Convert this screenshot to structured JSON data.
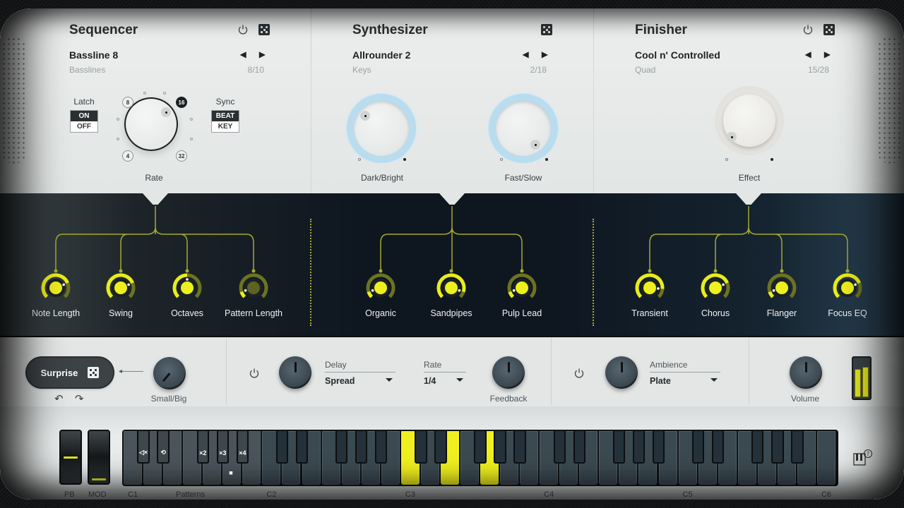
{
  "sequencer": {
    "title": "Sequencer",
    "preset": "Bassline 8",
    "category": "Basslines",
    "counter": "8/10",
    "latch": {
      "label": "Latch",
      "options": [
        "ON",
        "OFF"
      ],
      "selected": "ON"
    },
    "sync": {
      "label": "Sync",
      "options": [
        "BEAT",
        "KEY"
      ],
      "selected": "BEAT"
    },
    "rate": {
      "label": "Rate",
      "positions": [
        "4",
        "8",
        "16",
        "32"
      ],
      "selected": "16"
    },
    "icons": [
      "power-icon",
      "dice-icon"
    ]
  },
  "synthesizer": {
    "title": "Synthesizer",
    "preset": "Allrounder 2",
    "category": "Keys",
    "counter": "2/18",
    "knobs": [
      {
        "label": "Dark/Bright",
        "value": 0.15
      },
      {
        "label": "Fast/Slow",
        "value": 0.8
      }
    ],
    "icons": [
      "dice-icon"
    ]
  },
  "finisher": {
    "title": "Finisher",
    "preset": "Cool n' Controlled",
    "category": "Quad",
    "counter": "15/28",
    "knob": {
      "label": "Effect",
      "value": 0.05
    },
    "icons": [
      "power-icon",
      "dice-icon"
    ]
  },
  "macros": {
    "sequencer": [
      {
        "label": "Note Length",
        "value": 0.75
      },
      {
        "label": "Swing",
        "value": 0.75
      },
      {
        "label": "Octaves",
        "value": 0.5
      },
      {
        "label": "Pattern Length",
        "value": 0.1
      }
    ],
    "synthesizer": [
      {
        "label": "Organic",
        "value": 0.1
      },
      {
        "label": "Sandpipes",
        "value": 0.9
      },
      {
        "label": "Pulp Lead",
        "value": 0.1
      }
    ],
    "finisher": [
      {
        "label": "Transient",
        "value": 0.85
      },
      {
        "label": "Chorus",
        "value": 0.75
      },
      {
        "label": "Flanger",
        "value": 0.1
      },
      {
        "label": "Focus EQ",
        "value": 0.75
      }
    ]
  },
  "bottom": {
    "surprise_label": "Surprise",
    "undo_icon": "↶",
    "redo_icon": "↷",
    "arrow": "◂———",
    "smallbig": {
      "label": "Small/Big",
      "value": 0.3
    },
    "delay": {
      "label": "Delay",
      "value": "Spread",
      "knob_value": 0.5
    },
    "rate": {
      "label": "Rate",
      "value": "1/4"
    },
    "feedback": {
      "label": "Feedback",
      "value": 0.5
    },
    "ambience": {
      "label": "Ambience",
      "value": "Plate",
      "knob_value": 0.5
    },
    "volume": {
      "label": "Volume",
      "value": 0.5
    },
    "meter": {
      "left": 0.75,
      "right": 0.8
    }
  },
  "keyboard": {
    "wheels": [
      {
        "label": "PB",
        "value": 0.5
      },
      {
        "label": "MOD",
        "value": 0.0
      }
    ],
    "octave_labels": [
      "C1",
      "C2",
      "C3",
      "C4",
      "C5",
      "C6"
    ],
    "patterns_label": "Patterns",
    "pattern_keys": [
      "◁×",
      "⟲",
      "×2",
      "×3",
      "×4"
    ],
    "pattern_stop": "■",
    "pressed_notes": [
      "C3",
      "E3",
      "G3"
    ],
    "accent": "#f0f020"
  }
}
